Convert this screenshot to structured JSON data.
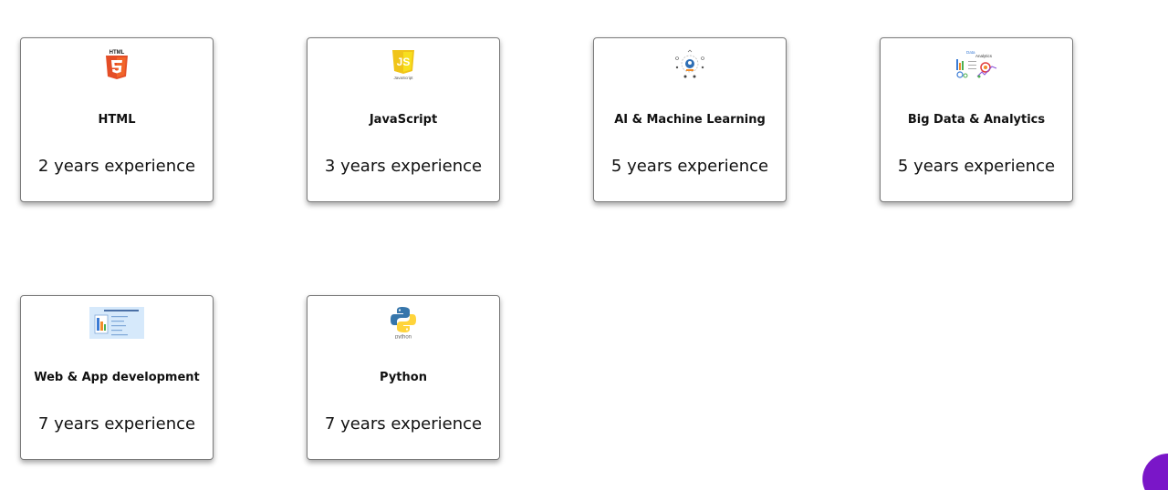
{
  "skills": [
    {
      "logo": "html5-icon",
      "logo_text": "HTML",
      "name": "HTML",
      "experience": "2 years experience"
    },
    {
      "logo": "javascript-icon",
      "logo_text": "JavaScript",
      "name": "JavaScript",
      "experience": "3 years experience"
    },
    {
      "logo": "ai-machine-learning-icon",
      "name": "AI & Machine Learning",
      "experience": "5 years experience"
    },
    {
      "logo": "big-data-analytics-icon",
      "logo_text_1": "Data",
      "logo_text_2": "Analytics",
      "name": "Big Data & Analytics",
      "experience": "5 years experience"
    },
    {
      "logo": "web-app-development-icon",
      "name": "Web & App development",
      "experience": "7 years experience"
    },
    {
      "logo": "python-icon",
      "logo_text": "python",
      "name": "Python",
      "experience": "7 years experience"
    }
  ],
  "colors": {
    "html5_orange": "#e44d26",
    "js_yellow": "#f0c419",
    "python_blue": "#3776ab",
    "python_yellow": "#ffd43b",
    "fab_purple": "#7a16c8"
  },
  "fab": {
    "icon": "floating-action-button"
  }
}
